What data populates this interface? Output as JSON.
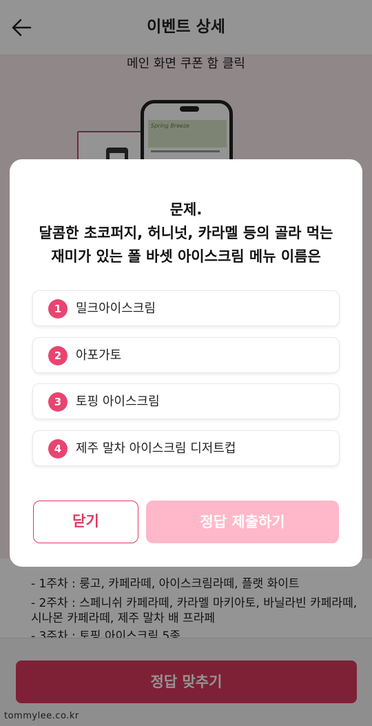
{
  "header": {
    "title": "이벤트 상세",
    "back_icon": "arrow-left-icon"
  },
  "background": {
    "step_caption": "메인 화면  쿠폰 함 클릭",
    "phone_banner_text": "Spring Breeze",
    "list_lines": [
      "- 1주차 :  룽고, 카페라떼, 아이스크림라떼, 플랫 화이트",
      "- 2주차 :  스페니쉬 카페라떼, 카라멜 마키아토, 바닐라빈 카페라떼,",
      "              시나몬 카페라떼, 제주 말차 배 프라페",
      "- 3주차 :  토핑 아이스크림 5종"
    ],
    "main_cta": "정답 맞추기",
    "watermark": "tommylee.co.kr"
  },
  "modal": {
    "question_title": "문제.",
    "question_line1": "달콤한 초코퍼지, 허니넛, 카라멜 등의 골라 먹는",
    "question_line2": "재미가 있는 폴 바셋 아이스크림 메뉴 이름은",
    "options": [
      {
        "num": "1",
        "label": "밀크아이스크림"
      },
      {
        "num": "2",
        "label": "아포가토"
      },
      {
        "num": "3",
        "label": "토핑 아이스크림"
      },
      {
        "num": "4",
        "label": "제주 말차 아이스크림 디저트컵"
      }
    ],
    "close_label": "닫기",
    "submit_label": "정답 제출하기"
  },
  "colors": {
    "accent": "#e0375f",
    "submit_disabled": "#ffb8c9",
    "option_badge": "#e84570"
  }
}
